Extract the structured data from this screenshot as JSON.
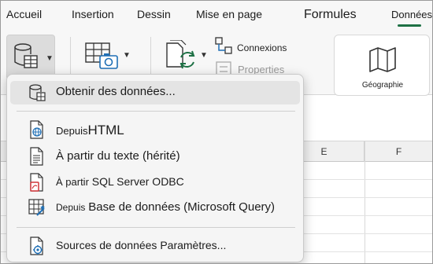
{
  "tabs": {
    "accueil": "Accueil",
    "insertion": "Insertion",
    "dessin": "Dessin",
    "mise_en_page": "Mise en page",
    "formules": "Formules",
    "donnees": "Données"
  },
  "ribbon": {
    "connexions": "Connexions",
    "properties": "Properties",
    "geographie": "Géographie"
  },
  "columns": [
    "E",
    "F"
  ],
  "menu": {
    "obtenir": "Obtenir des données...",
    "depuis_html_a": "Depuis",
    "depuis_html_b": "HTML",
    "texte": "À partir du texte (hérité)",
    "sql_a": "À partir",
    "sql_b": "SQL Server ODBC",
    "bdd_a": "Depuis",
    "bdd_b": "Base de données (Microsoft Query)",
    "sources": "Sources de données Paramètres..."
  },
  "colors": {
    "accent_green": "#1e7145",
    "icon_blue": "#1f6fb5",
    "icon_red": "#d13438"
  }
}
